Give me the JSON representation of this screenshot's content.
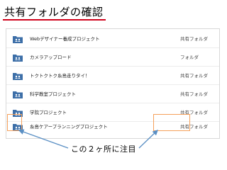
{
  "title": "共有フォルダの確認",
  "accent_color": "#d0021b",
  "highlight_color": "#f5a05a",
  "arrow_color": "#5a8fc4",
  "items": [
    {
      "name": "Webデザイナー養成プロジェクト",
      "type": "共有フォルダ",
      "icon": "shared-folder-icon"
    },
    {
      "name": "カメラアップロード",
      "type": "フォルダ",
      "icon": "shared-folder-icon"
    },
    {
      "name": "トクトクトク糸島走りタイ！",
      "type": "共有フォルダ",
      "icon": "shared-folder-icon"
    },
    {
      "name": "科学教室プロジェクト",
      "type": "共有フォルダ",
      "icon": "shared-folder-icon"
    },
    {
      "name": "学院プロジェクト",
      "type": "共有フォルダ",
      "icon": "shared-folder-icon"
    },
    {
      "name": "糸島ケアープランニングプロジェクト",
      "type": "共有フォルダ",
      "icon": "shared-folder-icon"
    }
  ],
  "note": "この２ヶ所に注目"
}
